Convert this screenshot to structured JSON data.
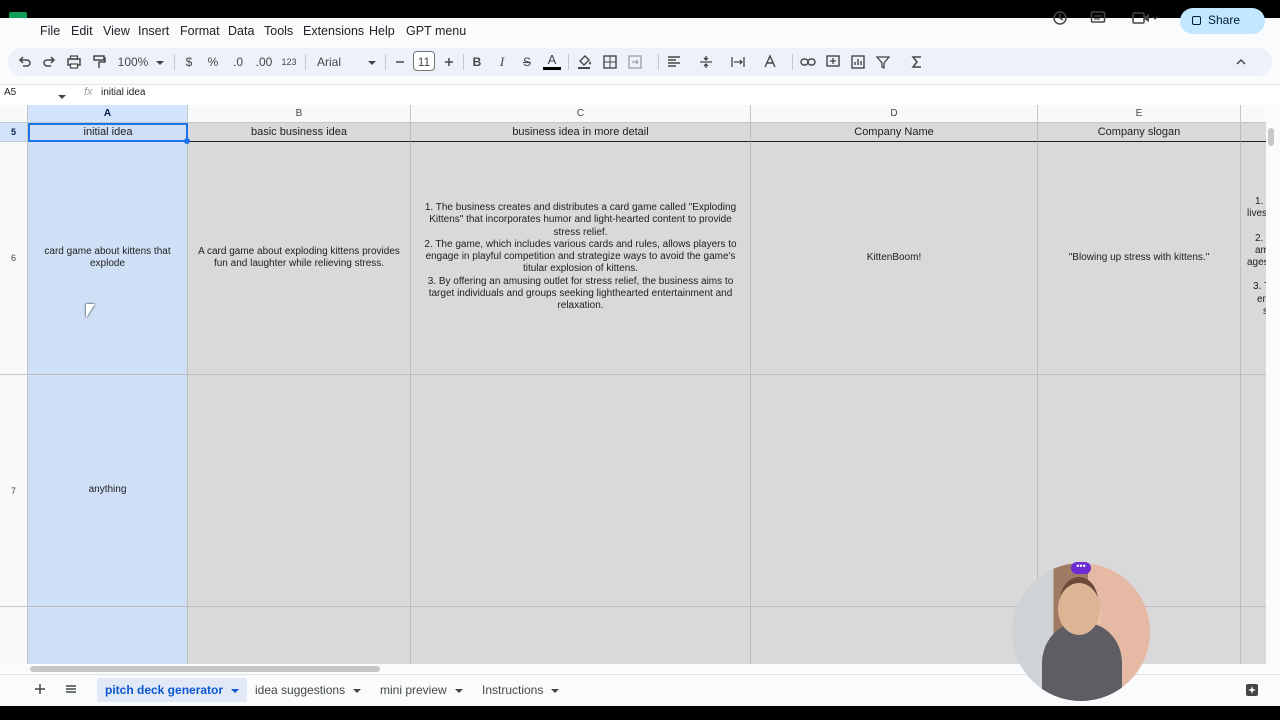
{
  "menu": [
    "File",
    "Edit",
    "View",
    "Insert",
    "Format",
    "Data",
    "Tools",
    "Extensions",
    "Help",
    "GPT menu"
  ],
  "header": {
    "share_label": "Share"
  },
  "toolbar": {
    "zoom": "100%",
    "currency": "$",
    "percent": "%",
    "dec_decrease": ".0",
    "dec_increase": ".00",
    "format_123": "123",
    "font": "Arial",
    "font_size": "11",
    "bold": "B",
    "italic": "I",
    "strike": "S",
    "text_color": "A"
  },
  "formula_bar": {
    "name_box": "A5",
    "fx": "fx",
    "value": "initial idea"
  },
  "columns": [
    "A",
    "B",
    "C",
    "D",
    "E"
  ],
  "rows": [
    {
      "num": "5",
      "cells": [
        "initial idea",
        "basic business idea",
        "business idea in more detail",
        "Company Name",
        "Company slogan"
      ]
    },
    {
      "num": "6",
      "cells": [
        "card game about kittens that explode",
        "A card game about exploding kittens provides fun and laughter while relieving stress.",
        "",
        "KittenBoom!",
        "\"Blowing up stress with kittens.\""
      ]
    },
    {
      "num": "7",
      "cells": [
        "anything",
        "",
        "",
        "",
        ""
      ]
    }
  ],
  "detail_lines": [
    "1. The business creates and distributes a card game called \"Exploding Kittens\" that incorporates humor and light-hearted content to provide stress relief.",
    "2. The game, which includes various cards and rules, allows players to engage in playful competition and strategize ways to avoid the game's titular explosion of kittens.",
    "3. By offering an amusing outlet for stress relief, the business aims to target individuals and groups seeking lighthearted entertainment and relaxation."
  ],
  "partial_col_f": [
    "1.",
    "lives",
    "2.",
    "am",
    "ages",
    "3. T",
    "en",
    "s"
  ],
  "sheet_tabs": [
    "pitch deck generator",
    "idea suggestions",
    "mini preview",
    "Instructions"
  ],
  "webcam_badge": "•••"
}
